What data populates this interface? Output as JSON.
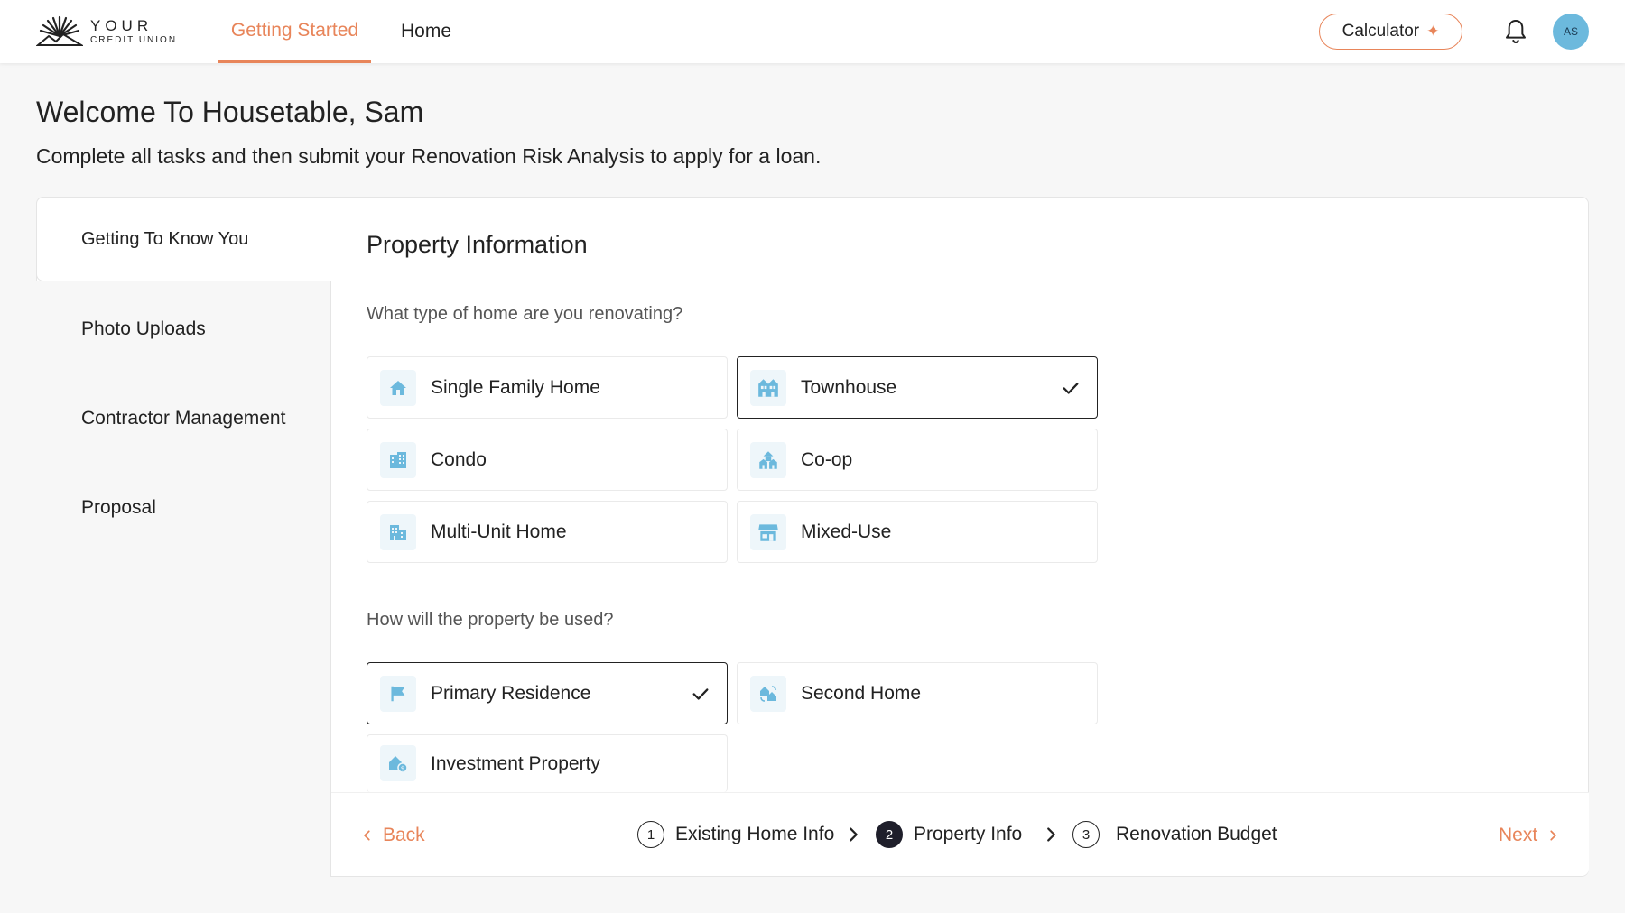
{
  "header": {
    "logo_top": "YOUR",
    "logo_bottom": "CREDIT UNION",
    "tabs": [
      {
        "label": "Getting Started",
        "active": true
      },
      {
        "label": "Home",
        "active": false
      }
    ],
    "calculator_label": "Calculator",
    "avatar_initials": "AS"
  },
  "welcome": {
    "title": "Welcome To Housetable, Sam",
    "subtitle": "Complete all tasks and then submit your Renovation Risk Analysis to apply for a loan."
  },
  "sidebar": {
    "items": [
      {
        "label": "Getting To Know You",
        "active": true
      },
      {
        "label": "Photo Uploads",
        "active": false
      },
      {
        "label": "Contractor Management",
        "active": false
      },
      {
        "label": "Proposal",
        "active": false
      }
    ]
  },
  "main": {
    "section_title": "Property Information",
    "home_type": {
      "question": "What type of home are you renovating?",
      "options": [
        {
          "label": "Single Family Home",
          "icon": "house-icon",
          "selected": false
        },
        {
          "label": "Townhouse",
          "icon": "townhouse-icon",
          "selected": true
        },
        {
          "label": "Condo",
          "icon": "building-icon",
          "selected": false
        },
        {
          "label": "Co-op",
          "icon": "co-op-icon",
          "selected": false
        },
        {
          "label": "Multi-Unit Home",
          "icon": "multi-unit-icon",
          "selected": false
        },
        {
          "label": "Mixed-Use",
          "icon": "storefront-icon",
          "selected": false
        }
      ]
    },
    "property_use": {
      "question": "How will the property be used?",
      "options": [
        {
          "label": "Primary Residence",
          "icon": "flag-icon",
          "selected": true
        },
        {
          "label": "Second Home",
          "icon": "swap-home-icon",
          "selected": false
        },
        {
          "label": "Investment Property",
          "icon": "investment-icon",
          "selected": false
        }
      ]
    }
  },
  "footer": {
    "back_label": "Back",
    "next_label": "Next",
    "steps": [
      {
        "num": "1",
        "label": "Existing Home Info",
        "active": false
      },
      {
        "num": "2",
        "label": "Property Info",
        "active": true
      },
      {
        "num": "3",
        "label": "Renovation Budget",
        "active": false
      }
    ]
  },
  "colors": {
    "accent": "#e8855a",
    "icon_blue": "#6cb9dd",
    "icon_bg": "#eef6fa",
    "avatar_bg": "#6cb9dd"
  }
}
